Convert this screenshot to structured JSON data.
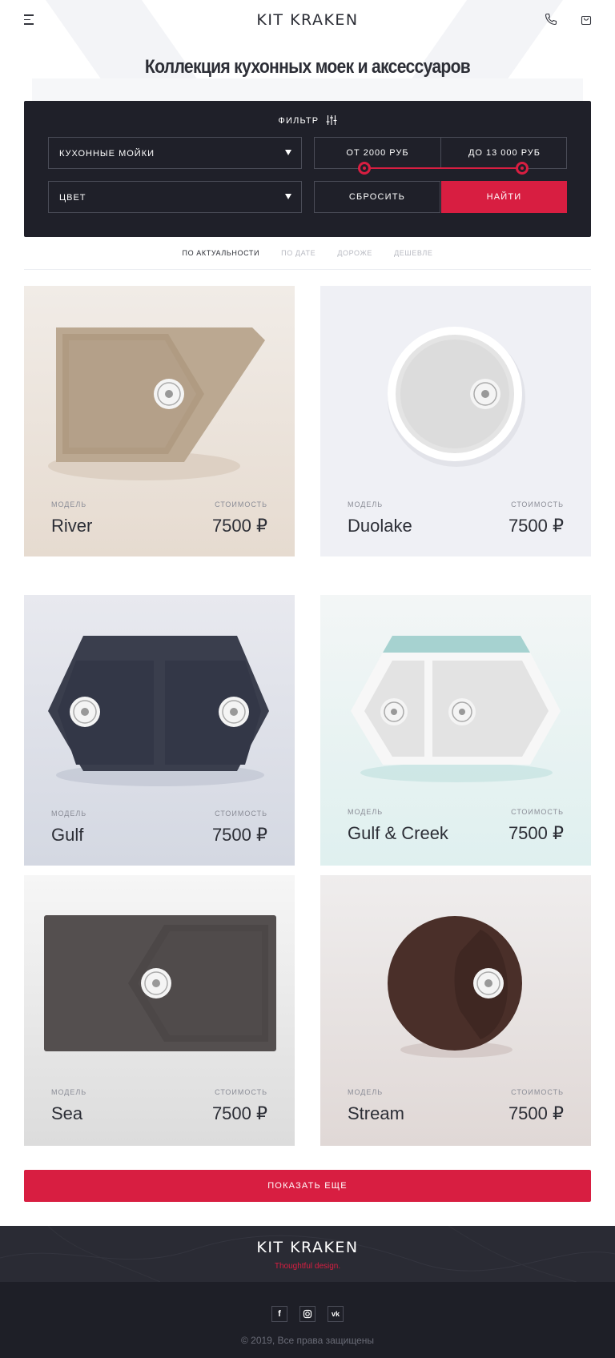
{
  "header": {
    "logo": "KIT KRAKEN",
    "menu_icon": "menu-icon",
    "phone_icon": "phone-icon",
    "cart_icon": "cart-icon"
  },
  "page_title": "Коллекция кухонных моек и аксессуаров",
  "filter": {
    "title": "ФИЛЬТР",
    "category": "КУХОННЫЕ МОЙКИ",
    "color": "ЦВЕТ",
    "price_from": "ОТ 2000 РУБ",
    "price_to": "ДО 13 000 РУБ",
    "reset_label": "СБРОСИТЬ",
    "find_label": "НАЙТИ"
  },
  "sort": {
    "options": [
      "ПО АКТУАЛЬНОСТИ",
      "ПО ДАТЕ",
      "ДОРОЖЕ",
      "ДЕШЕВЛЕ"
    ],
    "active": "ПО АКТУАЛЬНОСТИ"
  },
  "products": [
    {
      "model_label": "МОДЕЛЬ",
      "price_label": "СТОИМОСТЬ",
      "name": "River",
      "price": "7500 ₽"
    },
    {
      "model_label": "МОДЕЛЬ",
      "price_label": "СТОИМОСТЬ",
      "name": "Duolake",
      "price": "7500 ₽"
    },
    {
      "model_label": "МОДЕЛЬ",
      "price_label": "СТОИМОСТЬ",
      "name": "Gulf",
      "price": "7500 ₽"
    },
    {
      "model_label": "МОДЕЛЬ",
      "price_label": "СТОИМОСТЬ",
      "name": "Gulf & Creek",
      "price": "7500 ₽"
    },
    {
      "model_label": "МОДЕЛЬ",
      "price_label": "СТОИМОСТЬ",
      "name": "Sea",
      "price": "7500 ₽"
    },
    {
      "model_label": "МОДЕЛЬ",
      "price_label": "СТОИМОСТЬ",
      "name": "Stream",
      "price": "7500 ₽"
    }
  ],
  "show_more_label": "ПОКАЗАТЬ ЕЩЕ",
  "footer": {
    "logo": "KIT KRAKEN",
    "tagline": "Thoughtful design.",
    "socials": [
      "f",
      "ig",
      "vk"
    ],
    "copyright": "© 2019, Все права защищены"
  },
  "colors": {
    "accent": "#d81e41",
    "dark": "#1f2029",
    "footer_top": "#2a2b34"
  }
}
